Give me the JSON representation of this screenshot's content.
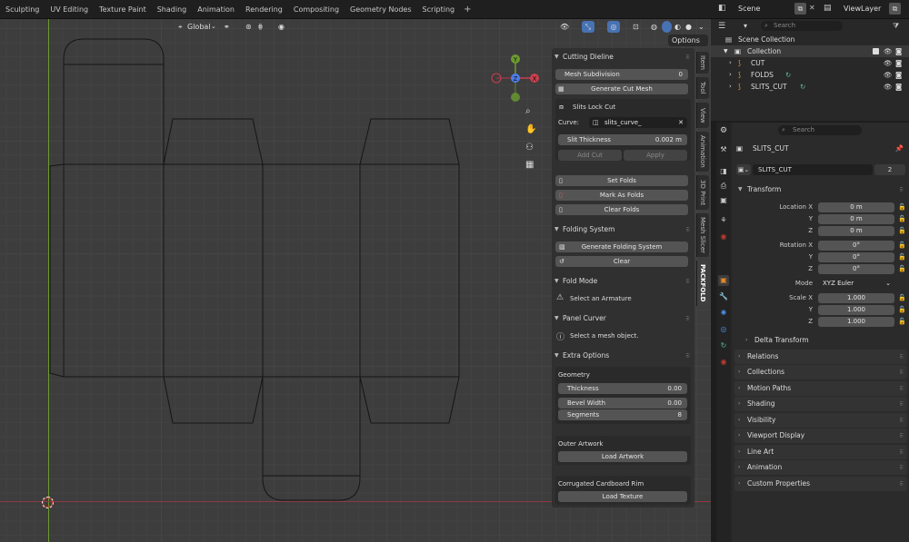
{
  "workspace_tabs": [
    "Sculpting",
    "UV Editing",
    "Texture Paint",
    "Shading",
    "Animation",
    "Rendering",
    "Compositing",
    "Geometry Nodes",
    "Scripting"
  ],
  "add_workspace": "+",
  "scene": {
    "label": "Scene",
    "view_layer": "ViewLayer",
    "search_placeholder": "Search"
  },
  "viewport_header": {
    "orientation": "Global",
    "options": "Options"
  },
  "npanel": {
    "cutting_dieline": "Cutting Dieline",
    "mesh_subdivision_label": "Mesh Subdivision",
    "mesh_subdivision_value": "0",
    "generate_cut_mesh": "Generate Cut Mesh",
    "slits_lock_cut": "Slits Lock Cut",
    "curve_label": "Curve:",
    "curve_value": "slits_curve_",
    "slit_thickness_label": "Slit Thickness",
    "slit_thickness_value": "0.002 m",
    "add_cut": "Add Cut",
    "apply": "Apply",
    "set_folds": "Set Folds",
    "mark_as_folds": "Mark As Folds",
    "clear_folds": "Clear Folds",
    "folding_system": "Folding System",
    "generate_folding_system": "Generate Folding System",
    "clear": "Clear",
    "fold_mode": "Fold Mode",
    "select_armature": "Select an Armature",
    "panel_curver": "Panel Curver",
    "select_mesh": "Select a mesh object.",
    "extra_options": "Extra Options",
    "geometry": "Geometry",
    "thickness_label": "Thickness",
    "thickness_value": "0.00",
    "bevel_width_label": "Bevel Width",
    "bevel_width_value": "0.00",
    "segments_label": "Segments",
    "segments_value": "8",
    "outer_artwork": "Outer Artwork",
    "load_artwork": "Load Artwork",
    "corrugated_rim": "Corrugated Cardboard Rim",
    "load_texture": "Load Texture"
  },
  "side_tabs": [
    "Item",
    "Tool",
    "View",
    "Animation",
    "3D Print",
    "Mesh Slicer",
    "PACKFOLD"
  ],
  "outliner": {
    "scene_collection": "Scene Collection",
    "collection": "Collection",
    "items": [
      "CUT",
      "FOLDS",
      "SLITS_CUT"
    ]
  },
  "properties": {
    "search_placeholder": "Search",
    "object_name": "SLITS_CUT",
    "data_name": "SLITS_CUT",
    "users": "2",
    "transform": "Transform",
    "location_x_label": "Location X",
    "location": [
      "0 m",
      "0 m",
      "0 m"
    ],
    "rotation_x_label": "Rotation X",
    "rotation": [
      "0°",
      "0°",
      "0°"
    ],
    "mode_label": "Mode",
    "mode_value": "XYZ Euler",
    "scale_x_label": "Scale X",
    "scale": [
      "1.000",
      "1.000",
      "1.000"
    ],
    "y_label": "Y",
    "z_label": "Z",
    "delta_transform": "Delta Transform",
    "sections": [
      "Relations",
      "Collections",
      "Motion Paths",
      "Shading",
      "Visibility",
      "Viewport Display",
      "Line Art",
      "Animation",
      "Custom Properties"
    ]
  },
  "colors": {
    "accent": "#4772b3",
    "x_axis": "#c8404f",
    "y_axis": "#6a9a2f",
    "z_axis": "#4c7ee8"
  }
}
